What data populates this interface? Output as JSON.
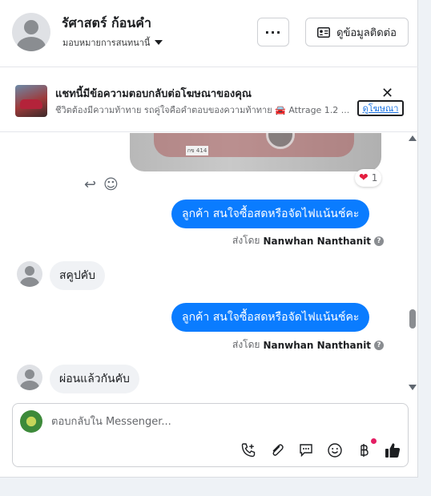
{
  "header": {
    "contact_name": "รัศาสตร์ ก้อนคำ",
    "assign_label": "มอบหมายการสนทนานี้",
    "more_label": "···",
    "view_contact_label": "ดูข้อมูลติดต่อ"
  },
  "ad_banner": {
    "title": "แชทนี้มีข้อความตอบกลับต่อโฆษณาของคุณ",
    "description": "ชีวิตต้องมีความท้าทาย รถคู่ใจคือคำตอบของความท้าทาย 🚘 Attrage 1.2 ...",
    "view_ad_label": "ดูโฆษณา",
    "close_label": "✕"
  },
  "messages": {
    "plate_text": "กข 414",
    "reaction_emoji": "❤",
    "reaction_count": "1",
    "outgoing_1": "ลูกค้า สนใจซื้อสดหรือจัดไฟแน้นช์คะ",
    "sent_by_prefix_1": "ส่งโดย",
    "sent_by_name_1": "Nanwhan Nanthanit",
    "incoming_1": "สคูปคับ",
    "outgoing_2": "ลูกค้า สนใจซื้อสดหรือจัดไฟแน้นช์คะ",
    "sent_by_prefix_2": "ส่งโดย",
    "sent_by_name_2": "Nanwhan Nanthanit",
    "incoming_2": "ผ่อนแล้วกันคับ",
    "question_mark": "?"
  },
  "composer": {
    "placeholder": "ตอบกลับใน Messenger..."
  },
  "icons": {
    "reply": "↩",
    "emoji": "☺",
    "call": "call-add-icon",
    "attach": "paperclip-icon",
    "saved_replies": "chat-bubble-icon",
    "emoji_picker": "smiley-icon",
    "payment": "baht-icon",
    "like": "thumbs-up-icon"
  },
  "colors": {
    "outgoing_bubble": "#0a7cff",
    "incoming_bubble": "#f0f2f5",
    "notification_dot": "#e41e63"
  }
}
